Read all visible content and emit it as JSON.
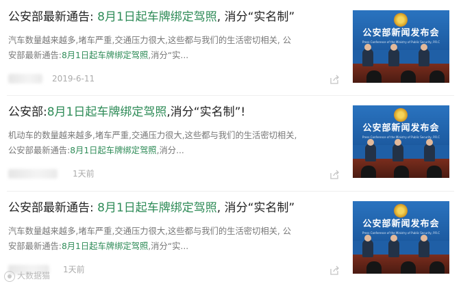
{
  "articles": [
    {
      "title_pre": "公安部最新通告: ",
      "title_hl": "8月1日起车牌绑定驾照",
      "title_post": ", 消分“实名制”",
      "line1": "汽车数量越来越多,堵车严重,交通压力很大,这些都与我们的生活密切相关, 公",
      "line2_pre": "安部最新通告:",
      "line2_hl": "8月1日起车牌绑定驾照",
      "line2_post": ",消分“实...",
      "date": "2019-6-11",
      "thumb_banner": "公安部新闻发布会",
      "thumb_sub": "Press Conference of the Ministry of Public Security, P.R.C"
    },
    {
      "title_pre": "公安部:",
      "title_hl": "8月1日起车牌绑定驾照",
      "title_post": ",消分“实名制”!",
      "line1": "机动车的数量越来越多,堵车严重,交通压力很大,这些都与我们的生活密切相关,",
      "line2_pre": "公安部最新通告:",
      "line2_hl": "8月1日起车牌绑定驾照",
      "line2_post": ",消分...",
      "date": "1天前",
      "thumb_banner": "公安部新闻发布会",
      "thumb_sub": "Press Conference of the Ministry of Public Security, P.R.C"
    },
    {
      "title_pre": "公安部最新通告: ",
      "title_hl": "8月1日起车牌绑定驾照",
      "title_post": ", 消分“实名制”",
      "line1": "汽车数量越来越多,堵车严重,交通压力很大,这些都与我们的生活密切相关, 公",
      "line2_pre": "安部最新通告:",
      "line2_hl": "8月1日起车牌绑定驾照",
      "line2_post": ",消分“实...",
      "date": "1天前",
      "thumb_banner": "公安部新闻发布会",
      "thumb_sub": "Press Conference of the Ministry of Public Security, P.R.C"
    }
  ],
  "watermark": "大数据猫",
  "colors": {
    "highlight": "#2e8b57",
    "title": "#222222",
    "abstract": "#777777",
    "meta": "#aaaaaa"
  },
  "icons": {
    "share": "share-icon",
    "thumbnail": "press-conference-image"
  }
}
